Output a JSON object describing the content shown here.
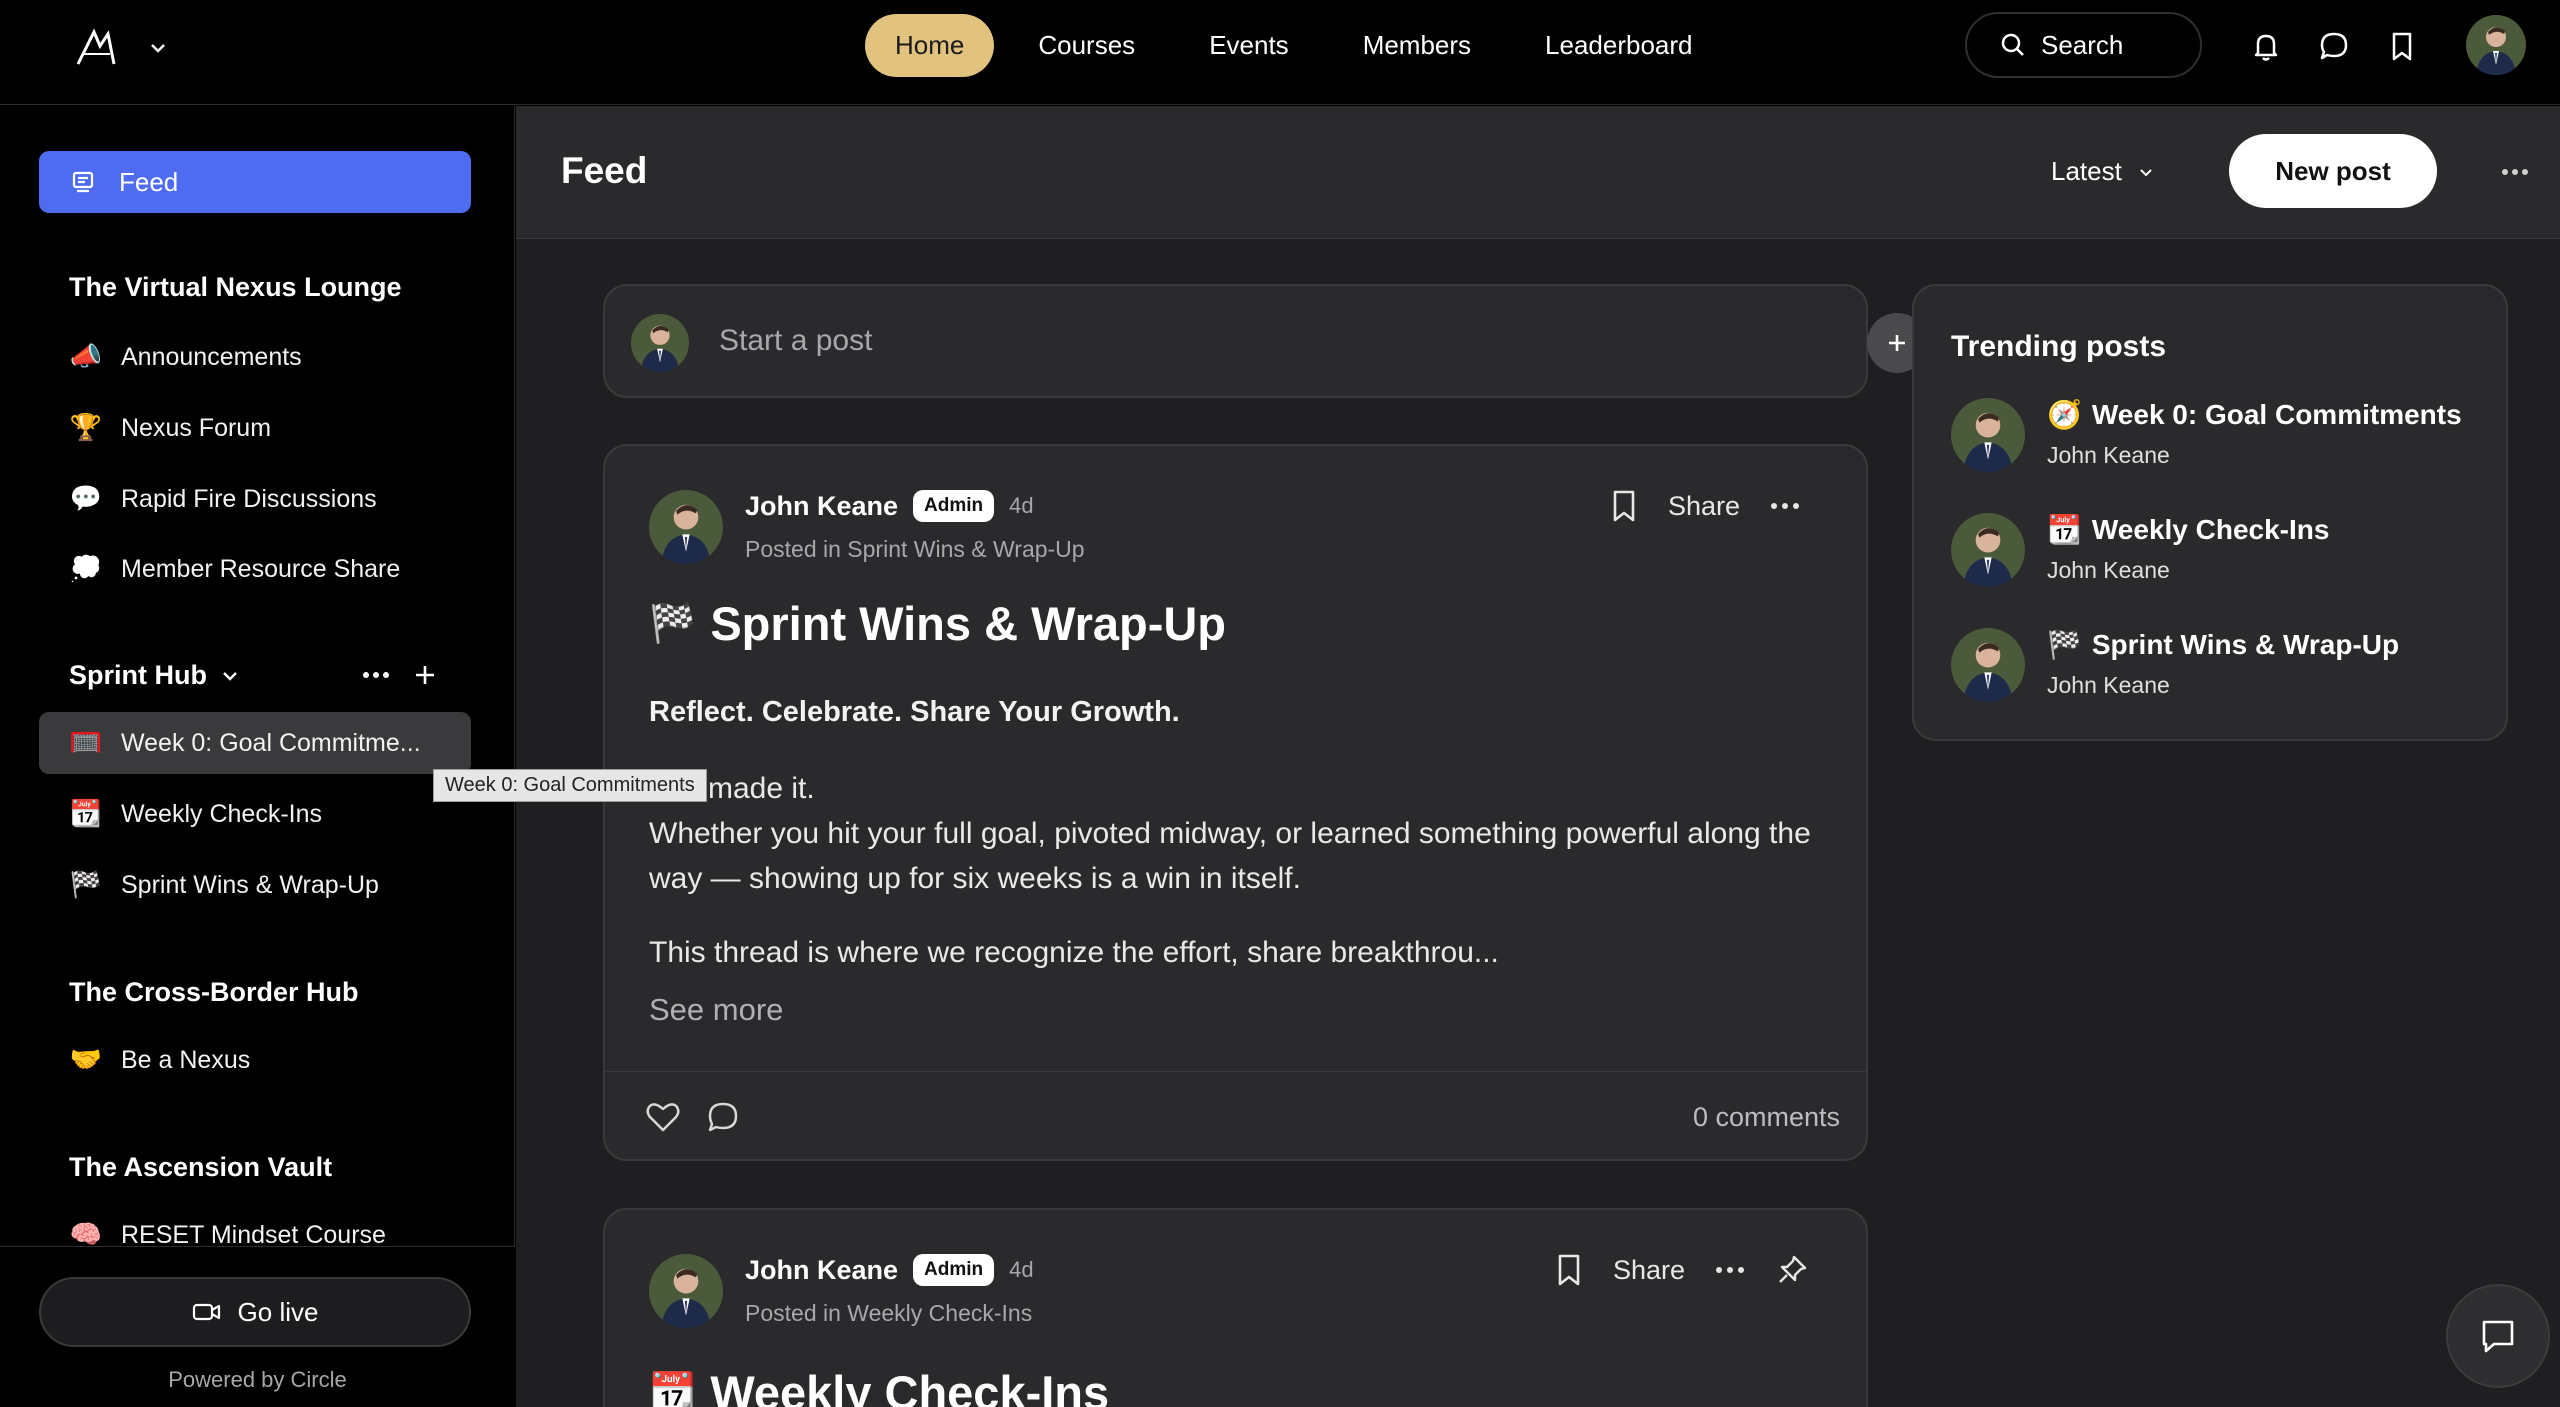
{
  "topbar": {
    "nav": [
      {
        "label": "Home",
        "active": true
      },
      {
        "label": "Courses",
        "active": false
      },
      {
        "label": "Events",
        "active": false
      },
      {
        "label": "Members",
        "active": false
      },
      {
        "label": "Leaderboard",
        "active": false
      }
    ],
    "search_label": "Search",
    "icons": [
      "bell-icon",
      "chat-icon",
      "bookmark-icon"
    ]
  },
  "sidebar": {
    "feed_label": "Feed",
    "sections": [
      {
        "title": "The Virtual Nexus Lounge",
        "items": [
          {
            "emoji": "📣",
            "label": "Announcements"
          },
          {
            "emoji": "🏆",
            "label": "Nexus Forum"
          },
          {
            "emoji": "💬",
            "label": "Rapid Fire Discussions"
          },
          {
            "emoji": "💭",
            "label": "Member Resource Share"
          }
        ]
      },
      {
        "title": "Sprint Hub",
        "items": [
          {
            "emoji": "🥅",
            "label": "Week 0: Goal Commitme..."
          },
          {
            "emoji": "📆",
            "label": "Weekly Check-Ins"
          },
          {
            "emoji": "🏁",
            "label": "Sprint Wins & Wrap-Up"
          }
        ]
      },
      {
        "title": "The Cross-Border Hub",
        "items": [
          {
            "emoji": "🤝",
            "label": "Be a Nexus"
          }
        ]
      },
      {
        "title": "The Ascension Vault",
        "items": [
          {
            "emoji": "🧠",
            "label": "RESET Mindset Course"
          }
        ]
      }
    ],
    "tooltip": "Week 0: Goal Commitments",
    "golive_label": "Go live",
    "powered_by": "Powered by Circle"
  },
  "main": {
    "title": "Feed",
    "sort_label": "Latest",
    "new_post_label": "New post",
    "composer_placeholder": "Start a post",
    "posts": [
      {
        "author": "John Keane",
        "badge": "Admin",
        "age": "4d",
        "posted_in": "Posted in Sprint Wins & Wrap-Up",
        "share_label": "Share",
        "title_emoji": "🏁",
        "title": "Sprint Wins & Wrap-Up",
        "subtitle": "Reflect. Celebrate. Share Your Growth.",
        "body": [
          "You made it.\nWhether you hit your full goal, pivoted midway, or learned something powerful along the way — showing up for six weeks is a win in itself.",
          "This thread is where we recognize the effort, share breakthrou..."
        ],
        "see_more": "See more",
        "comments": "0 comments"
      },
      {
        "author": "John Keane",
        "badge": "Admin",
        "age": "4d",
        "posted_in": "Posted in Weekly Check-Ins",
        "share_label": "Share",
        "title_emoji": "📆",
        "title": "Weekly Check-Ins"
      }
    ]
  },
  "trending": {
    "title": "Trending posts",
    "items": [
      {
        "emoji": "🧭",
        "title": "Week 0: Goal Commitments",
        "author": "John Keane"
      },
      {
        "emoji": "📆",
        "title": "Weekly Check-Ins",
        "author": "John Keane"
      },
      {
        "emoji": "🏁",
        "title": "Sprint Wins & Wrap-Up",
        "author": "John Keane"
      }
    ]
  },
  "colors": {
    "accent_nav": "#e1c27f",
    "feed_active": "#4f6cf0",
    "panel": "#2a2a2c",
    "background": "#1f1f21"
  }
}
